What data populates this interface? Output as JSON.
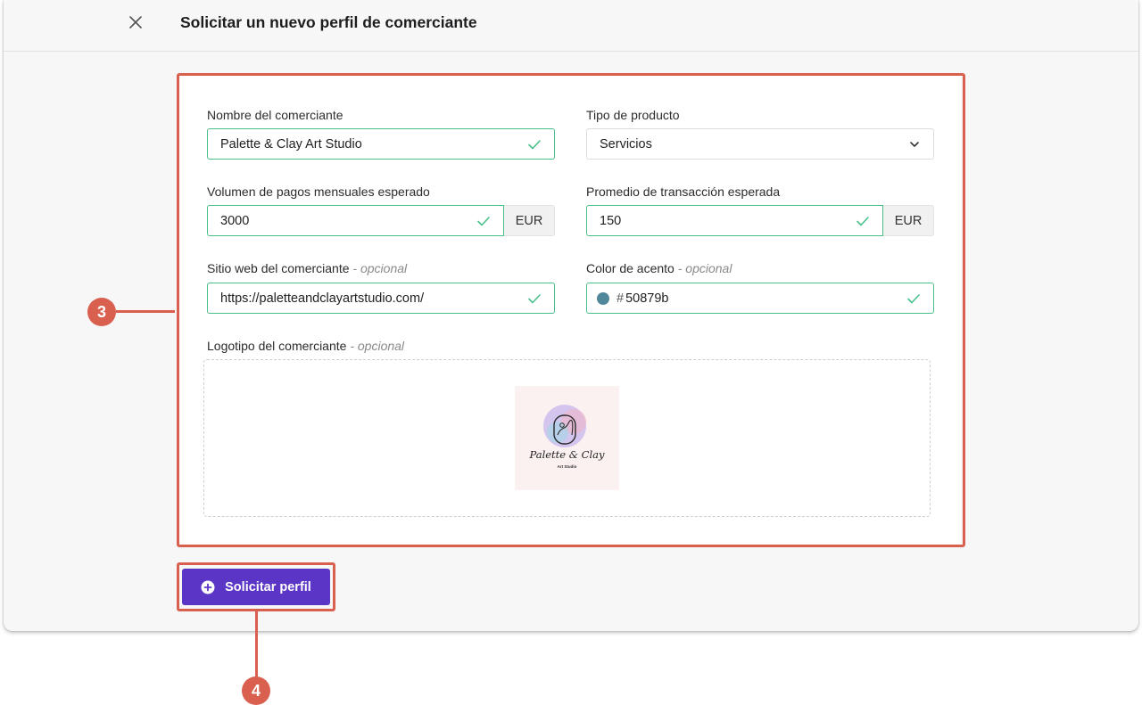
{
  "header": {
    "title": "Solicitar un nuevo perfil de comerciante"
  },
  "form": {
    "merchant_name": {
      "label": "Nombre del comerciante",
      "value": "Palette & Clay Art Studio"
    },
    "product_type": {
      "label": "Tipo de producto",
      "value": "Servicios"
    },
    "monthly_volume": {
      "label": "Volumen de pagos mensuales esperado",
      "value": "3000",
      "currency": "EUR"
    },
    "avg_transaction": {
      "label": "Promedio de transacción esperada",
      "value": "150",
      "currency": "EUR"
    },
    "website": {
      "label": "Sitio web del comerciante",
      "optional": "- opcional",
      "value": "https://paletteandclayartstudio.com/"
    },
    "accent_color": {
      "label": "Color de acento",
      "optional": "- opcional",
      "hash": "#",
      "value": "50879b",
      "swatch": "#50879b"
    },
    "logo": {
      "label": "Logotipo del comerciante",
      "optional": "- opcional",
      "logo_text": "Palette & Clay",
      "logo_subtext": "Art Studio"
    }
  },
  "submit": {
    "label": "Solicitar perfil"
  },
  "annotations": {
    "step_3": "3",
    "step_4": "4"
  },
  "colors": {
    "accent": "#5b35c5",
    "annotation": "#d9604f",
    "valid": "#49c08a"
  }
}
